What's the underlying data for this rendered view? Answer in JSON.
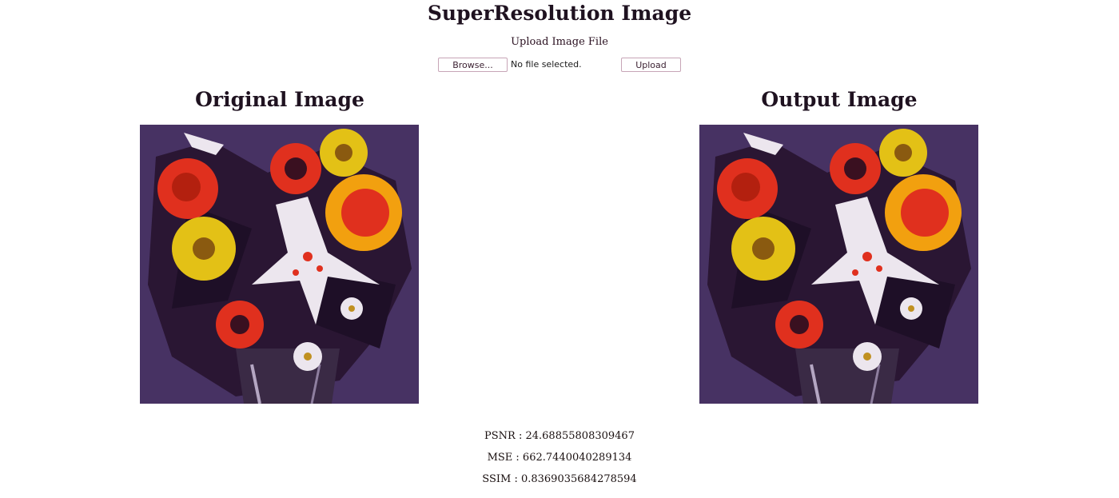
{
  "header": {
    "title": "SuperResolution Image"
  },
  "upload": {
    "label": "Upload Image File",
    "browse_label": "Browse...",
    "file_status": "No file selected.",
    "upload_label": "Upload"
  },
  "panels": {
    "original_heading": "Original Image",
    "output_heading": "Output Image",
    "image_subject": "flower-bouquet-illustration"
  },
  "metrics": {
    "psnr": "PSNR : 24.68855808309467",
    "mse": "MSE : 662.7440040289134",
    "ssim": "SSIM : 0.8369035684278594"
  },
  "colors": {
    "background": "#473263",
    "dark": "#2a1633",
    "red": "#e0301e",
    "yellow": "#e3c116",
    "orange": "#f2a00f",
    "white": "#ece6ee",
    "text": "#1f1220"
  }
}
